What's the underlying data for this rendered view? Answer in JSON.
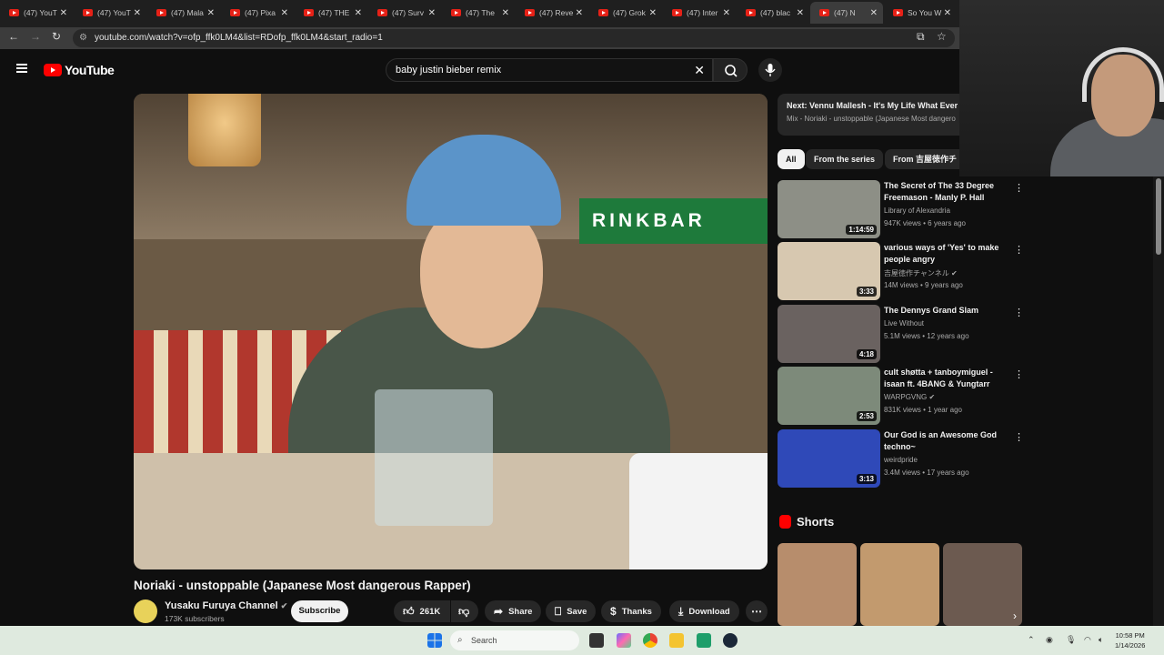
{
  "browser": {
    "tabs": [
      {
        "label": "(47) YouT",
        "active": false
      },
      {
        "label": "(47) YouT",
        "active": false
      },
      {
        "label": "(47) Mala",
        "active": false
      },
      {
        "label": "(47) Pixa",
        "active": false
      },
      {
        "label": "(47) THE",
        "active": false
      },
      {
        "label": "(47) Surv",
        "active": false
      },
      {
        "label": "(47) The",
        "active": false
      },
      {
        "label": "(47) Reve",
        "active": false
      },
      {
        "label": "(47) Grok",
        "active": false
      },
      {
        "label": "(47) Inter",
        "active": false
      },
      {
        "label": "(47) blac",
        "active": false
      },
      {
        "label": "(47) N",
        "active": true
      },
      {
        "label": "So You W",
        "active": false
      }
    ],
    "url": "youtube.com/watch?v=ofp_ffk0LM4&list=RDofp_ffk0LM4&start_radio=1"
  },
  "youtube": {
    "logo_text": "YouTube",
    "search_value": "baby justin bieber remix"
  },
  "video": {
    "sign_text": "RINKBAR",
    "title": "Noriaki - unstoppable (Japanese Most dangerous Rapper)",
    "channel": "Yusaku Furuya Channel",
    "subscribers": "173K subscribers",
    "subscribe_label": "Subscribe",
    "likes": "261K",
    "share_label": "Share",
    "save_label": "Save",
    "thanks_label": "Thanks",
    "download_label": "Download"
  },
  "sidebar": {
    "next_line1": "Next: Vennu Mallesh - It's My Life What Ever I",
    "next_line2": "Mix - Noriaki - unstoppable (Japanese Most dangero",
    "chips": [
      "All",
      "From the series",
      "From 吉屋徳作チ"
    ],
    "recommendations": [
      {
        "title": "The Secret of The 33 Degree Freemason - Manly P. Hall",
        "channel": "Library of Alexandria",
        "meta": "947K views • 6 years ago",
        "duration": "1:14:59",
        "verified": false,
        "color": "#8d8f86"
      },
      {
        "title": "various ways of 'Yes' to make people angry",
        "channel": "吉屋徳作チャンネル",
        "meta": "14M views • 9 years ago",
        "duration": "3:33",
        "verified": true,
        "color": "#d7c8b0"
      },
      {
        "title": "The Dennys Grand Slam",
        "channel": "Live Without",
        "meta": "5.1M views • 12 years ago",
        "duration": "4:18",
        "verified": false,
        "color": "#6a6260"
      },
      {
        "title": "cult shøtta + tanboymiguel - isaan ft. 4BANG & Yungtarr",
        "channel": "WARPGVNG",
        "meta": "831K views • 1 year ago",
        "duration": "2:53",
        "verified": true,
        "color": "#7d8a7a"
      },
      {
        "title": "Our God is an Awesome God techno~",
        "channel": "weirdpride",
        "meta": "3.4M views • 17 years ago",
        "duration": "3:13",
        "verified": false,
        "color": "#2f49b8"
      }
    ],
    "shorts_label": "Shorts",
    "shorts_colors": [
      "#b78d6c",
      "#c29a6e",
      "#6c5a50"
    ]
  },
  "taskbar": {
    "search_label": "Search",
    "time": "10:58 PM",
    "date": "1/14/2026"
  }
}
